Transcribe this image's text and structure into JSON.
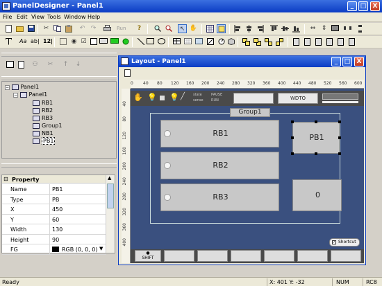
{
  "app": {
    "title": "PanelDesigner - Panel1",
    "caption_buttons": [
      "_",
      "□",
      "X"
    ]
  },
  "menu": [
    "File",
    "Edit",
    "View",
    "Tools",
    "Window",
    "Help"
  ],
  "toolbar1": {
    "run_label": "Run",
    "icons": [
      "new-icon",
      "open-icon",
      "save-icon",
      "cut-icon",
      "copy-icon",
      "paste-icon",
      "undo-icon",
      "redo-icon",
      "print-icon",
      "help-icon",
      "zoom-icon",
      "find-icon",
      "select-pointer-icon",
      "hand-icon",
      "grid-icon",
      "snap-icon",
      "align-left-icon",
      "align-center-icon",
      "align-right-icon",
      "align-top-icon",
      "align-middle-icon",
      "align-bottom-icon",
      "same-width-icon",
      "same-height-icon",
      "same-size-icon"
    ]
  },
  "toolbar2": {
    "text_tools": [
      "Aa",
      "ab|",
      "12|"
    ],
    "icons": [
      "text-icon",
      "edit-icon",
      "number-icon",
      "checkbox-icon",
      "radio-icon",
      "check-icon",
      "rect-icon",
      "line-icon",
      "rectangle-icon",
      "rounded-rect-icon",
      "circle-icon",
      "frame-icon",
      "table-icon",
      "image-icon",
      "meter-icon",
      "gauge-icon",
      "cube-icon",
      "bring-front-icon",
      "send-back-icon",
      "group-icon",
      "ungroup-icon",
      "order-icon",
      "lock-icon",
      "unlock-icon"
    ]
  },
  "tree": {
    "root": "Panel1",
    "child": "Panel1",
    "items": [
      "RB1",
      "RB2",
      "RB3",
      "Group1",
      "NB1",
      "PB1"
    ],
    "selected": "PB1"
  },
  "properties": {
    "header": "Property",
    "rows": [
      {
        "key": "Name",
        "value": "PB1"
      },
      {
        "key": "Type",
        "value": "PB"
      },
      {
        "key": "X",
        "value": "450"
      },
      {
        "key": "Y",
        "value": "60"
      },
      {
        "key": "Width",
        "value": "130"
      },
      {
        "key": "Height",
        "value": "90"
      },
      {
        "key": "FG",
        "value": "RGB (0, 0, 0)"
      }
    ]
  },
  "layout_window": {
    "title": "Layout - Panel1",
    "ruler_h": [
      "0",
      "40",
      "80",
      "120",
      "160",
      "200",
      "240",
      "280",
      "320",
      "360",
      "400",
      "440",
      "480",
      "520",
      "560",
      "600"
    ],
    "ruler_v": [
      "40",
      "80",
      "120",
      "160",
      "200",
      "240",
      "280",
      "320",
      "360",
      "400"
    ],
    "toolbar_button": "WDTO",
    "group_label": "Group1",
    "rb1": "RB1",
    "rb2": "RB2",
    "rb3": "RB3",
    "pb1": "PB1",
    "nb1": "0",
    "shortcut_label": "Shortcut",
    "shift_label": "SHIFT",
    "indicator_labels": [
      "state",
      "sense",
      "PAUSE",
      "RUN"
    ]
  },
  "status": {
    "ready": "Ready",
    "coords": "X: 401 Y: -32",
    "num": "NUM",
    "rc": "RC8"
  },
  "colors": {
    "canvas": "#3a507f",
    "title_bar": "#0b3cc4",
    "close": "#c23a20"
  }
}
